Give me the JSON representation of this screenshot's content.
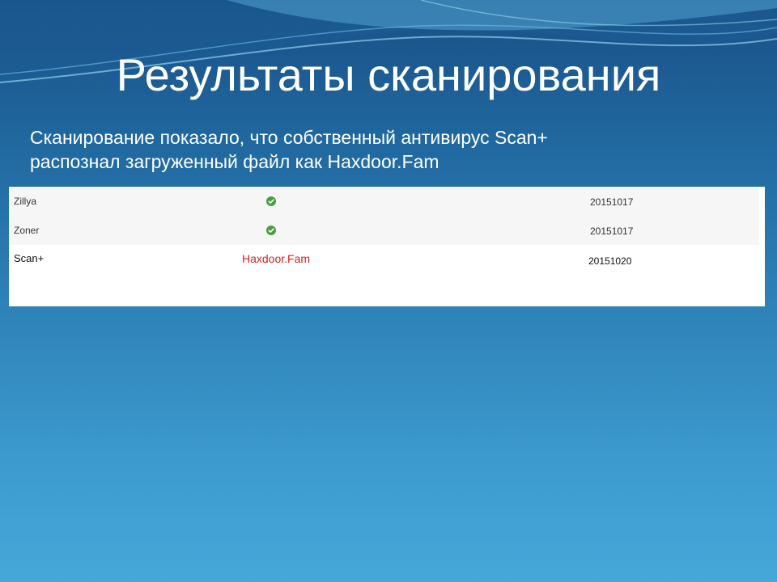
{
  "slide": {
    "title": "Результаты сканирования",
    "subtitle_line1": "Сканирование показало, что собственный антивирус Scan+",
    "subtitle_line2": "распознал загруженный файл как Haxdoor.Fam"
  },
  "results": {
    "rows": [
      {
        "engine": "Zillya",
        "result_icon": "check-circle-icon",
        "date": "20151017"
      },
      {
        "engine": "Zoner",
        "result_icon": "check-circle-icon",
        "date": "20151017"
      },
      {
        "engine": "Scan+",
        "result": "Haxdoor.Fam",
        "date": "20151020"
      }
    ]
  },
  "colors": {
    "clean": "#4a9e3f",
    "detected": "#d42020",
    "background_top": "#1a4f86",
    "background_bottom": "#46a7d9"
  }
}
